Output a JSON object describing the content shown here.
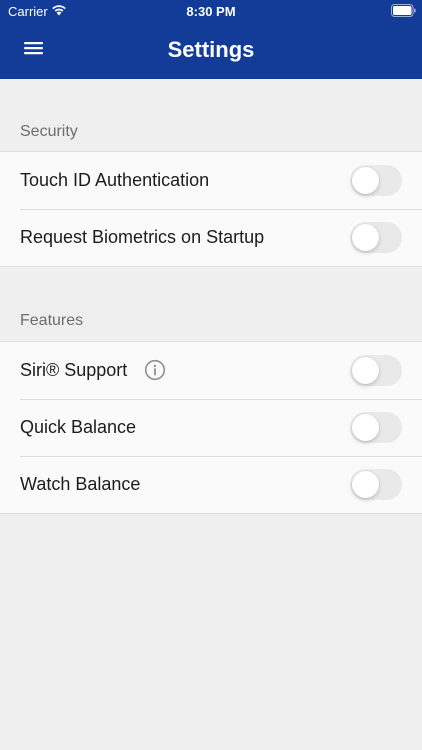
{
  "status_bar": {
    "carrier": "Carrier",
    "time": "8:30 PM",
    "wifi_icon": "wifi-icon",
    "battery_icon": "battery-icon"
  },
  "nav": {
    "title": "Settings",
    "menu_icon": "hamburger-menu-icon",
    "background_color": "#123c97"
  },
  "sections": {
    "security": {
      "header": "Security",
      "items": [
        {
          "label": "Touch ID Authentication",
          "enabled": false
        },
        {
          "label": "Request Biometrics on Startup",
          "enabled": false
        }
      ]
    },
    "features": {
      "header": "Features",
      "items": [
        {
          "label": "Siri® Support",
          "enabled": false,
          "icon": "info-icon"
        },
        {
          "label": "Quick Balance",
          "enabled": false
        },
        {
          "label": "Watch Balance",
          "enabled": false
        }
      ]
    }
  }
}
